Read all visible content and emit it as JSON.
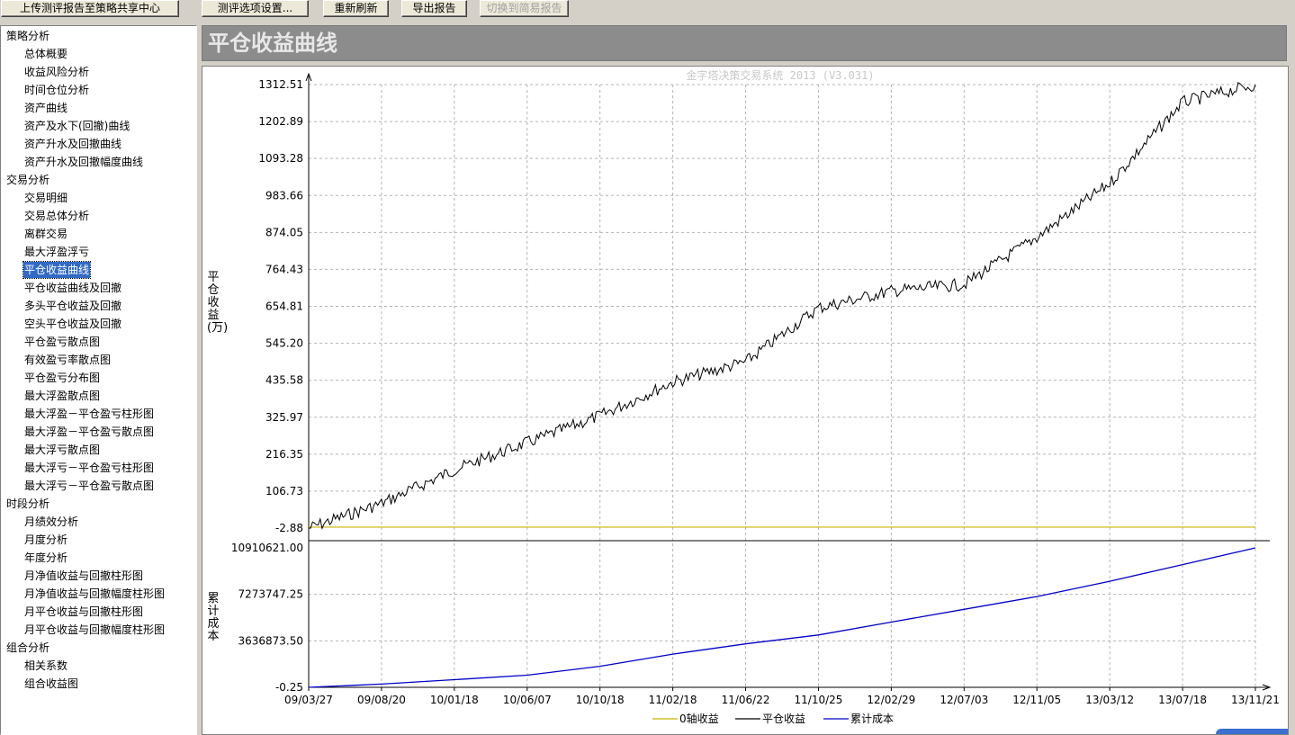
{
  "toolbar": {
    "upload_label": "上传测评报告至策略共享中心",
    "options_label": "测评选项设置...",
    "refresh_label": "重新刷新",
    "export_label": "导出报告",
    "switch_label": "切换到简易报告"
  },
  "sidebar": {
    "groups": [
      {
        "label": "策略分析",
        "items": [
          "总体概要",
          "收益风险分析",
          "时间仓位分析",
          "资产曲线",
          "资产及水下(回撤)曲线",
          "资产升水及回撤曲线",
          "资产升水及回撤幅度曲线"
        ]
      },
      {
        "label": "交易分析",
        "items": [
          "交易明细",
          "交易总体分析",
          "离群交易",
          "最大浮盈浮亏",
          "平仓收益曲线",
          "平仓收益曲线及回撤",
          "多头平仓收益及回撤",
          "空头平仓收益及回撤",
          "平仓盈亏散点图",
          "有效盈亏率散点图",
          "平仓盈亏分布图",
          "最大浮盈散点图",
          "最大浮盈－平仓盈亏柱形图",
          "最大浮盈－平仓盈亏散点图",
          "最大浮亏散点图",
          "最大浮亏－平仓盈亏柱形图",
          "最大浮亏－平仓盈亏散点图"
        ]
      },
      {
        "label": "时段分析",
        "items": [
          "月绩效分析",
          "月度分析",
          "年度分析",
          "月净值收益与回撤柱形图",
          "月净值收益与回撤幅度柱形图",
          "月平仓收益与回撤柱形图",
          "月平仓收益与回撤幅度柱形图"
        ]
      },
      {
        "label": "组合分析",
        "items": [
          "相关系数",
          "组合收益图"
        ]
      }
    ],
    "selected": "平仓收益曲线"
  },
  "page": {
    "title": "平仓收益曲线"
  },
  "chart_data": {
    "type": "line",
    "watermark": "金字塔决策交易系统 2013 (V3.031)",
    "top_panel": {
      "ylabel": "平仓收益(万)",
      "yticks": [
        "1312.51",
        "1202.89",
        "1093.28",
        "983.66",
        "874.05",
        "764.43",
        "654.81",
        "545.20",
        "435.58",
        "325.97",
        "216.35",
        "106.73",
        "-2.88"
      ],
      "ylim": [
        -2.88,
        1312.51
      ],
      "series": [
        {
          "name": "0轴收益",
          "color": "#c8b400",
          "x": [
            "09/03/27",
            "13/11/21"
          ],
          "values": [
            0,
            0
          ]
        },
        {
          "name": "平仓收益",
          "color": "#000000",
          "x": [
            "09/03/27",
            "09/08/20",
            "10/01/18",
            "10/06/07",
            "10/10/18",
            "11/02/18",
            "11/06/22",
            "11/10/25",
            "12/02/29",
            "12/07/03",
            "12/11/05",
            "13/03/12",
            "13/07/18",
            "13/11/21"
          ],
          "values": [
            -2.88,
            70,
            170,
            250,
            330,
            430,
            490,
            650,
            700,
            720,
            860,
            1020,
            1260,
            1312.51
          ]
        }
      ]
    },
    "bottom_panel": {
      "ylabel": "累计成本",
      "yticks": [
        "10910621.00",
        "7273747.25",
        "3636873.50",
        "-0.25"
      ],
      "ylim": [
        -0.25,
        10910621.0
      ],
      "series": [
        {
          "name": "累计成本",
          "color": "#0000c8",
          "x": [
            "09/03/27",
            "09/08/20",
            "10/01/18",
            "10/06/07",
            "10/10/18",
            "11/02/18",
            "11/06/22",
            "11/10/25",
            "12/02/29",
            "12/07/03",
            "12/11/05",
            "13/03/12",
            "13/07/18",
            "13/11/21"
          ],
          "values": [
            0,
            250000,
            600000,
            950000,
            1650000,
            2600000,
            3400000,
            4100000,
            5100000,
            6100000,
            7100000,
            8300000,
            9600000,
            10910621
          ]
        }
      ]
    },
    "xticks": [
      "09/03/27",
      "09/08/20",
      "10/01/18",
      "10/06/07",
      "10/10/18",
      "11/02/18",
      "11/06/22",
      "11/10/25",
      "12/02/29",
      "12/07/03",
      "12/11/05",
      "13/03/12",
      "13/07/18",
      "13/11/21"
    ],
    "legend": [
      "0轴收益",
      "平仓收益",
      "累计成本"
    ],
    "legend_position": "bottom",
    "grid": true
  }
}
